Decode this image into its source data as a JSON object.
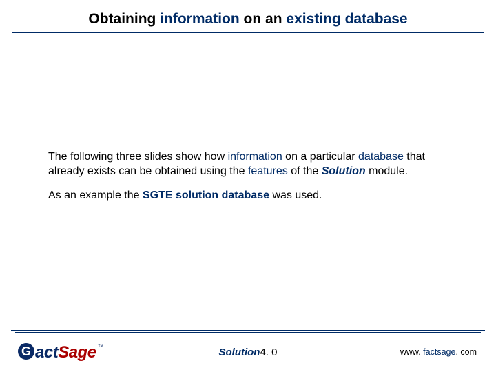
{
  "title": {
    "t1": "Obtaining ",
    "t2": "information",
    "t3": " on an ",
    "t4": "existing database"
  },
  "body": {
    "p1": {
      "a": "The following three slides show how ",
      "b": "information",
      "c": " on a particular ",
      "d": "database",
      "e": " that already exists can be obtained using the ",
      "f": "features",
      "g": " of the ",
      "h": "Solution",
      "i": " module."
    },
    "p2": {
      "a": "As an example the ",
      "b": "SGTE solution database",
      "c": " was used."
    }
  },
  "footer": {
    "logo": {
      "glyph": "G",
      "part1": "act",
      "part2": "Sage",
      "tm": "™"
    },
    "center": {
      "mod": "Solution",
      "ver": "4. 0"
    },
    "url": {
      "a": "www. ",
      "b": "factsage",
      "c": ". com"
    }
  }
}
